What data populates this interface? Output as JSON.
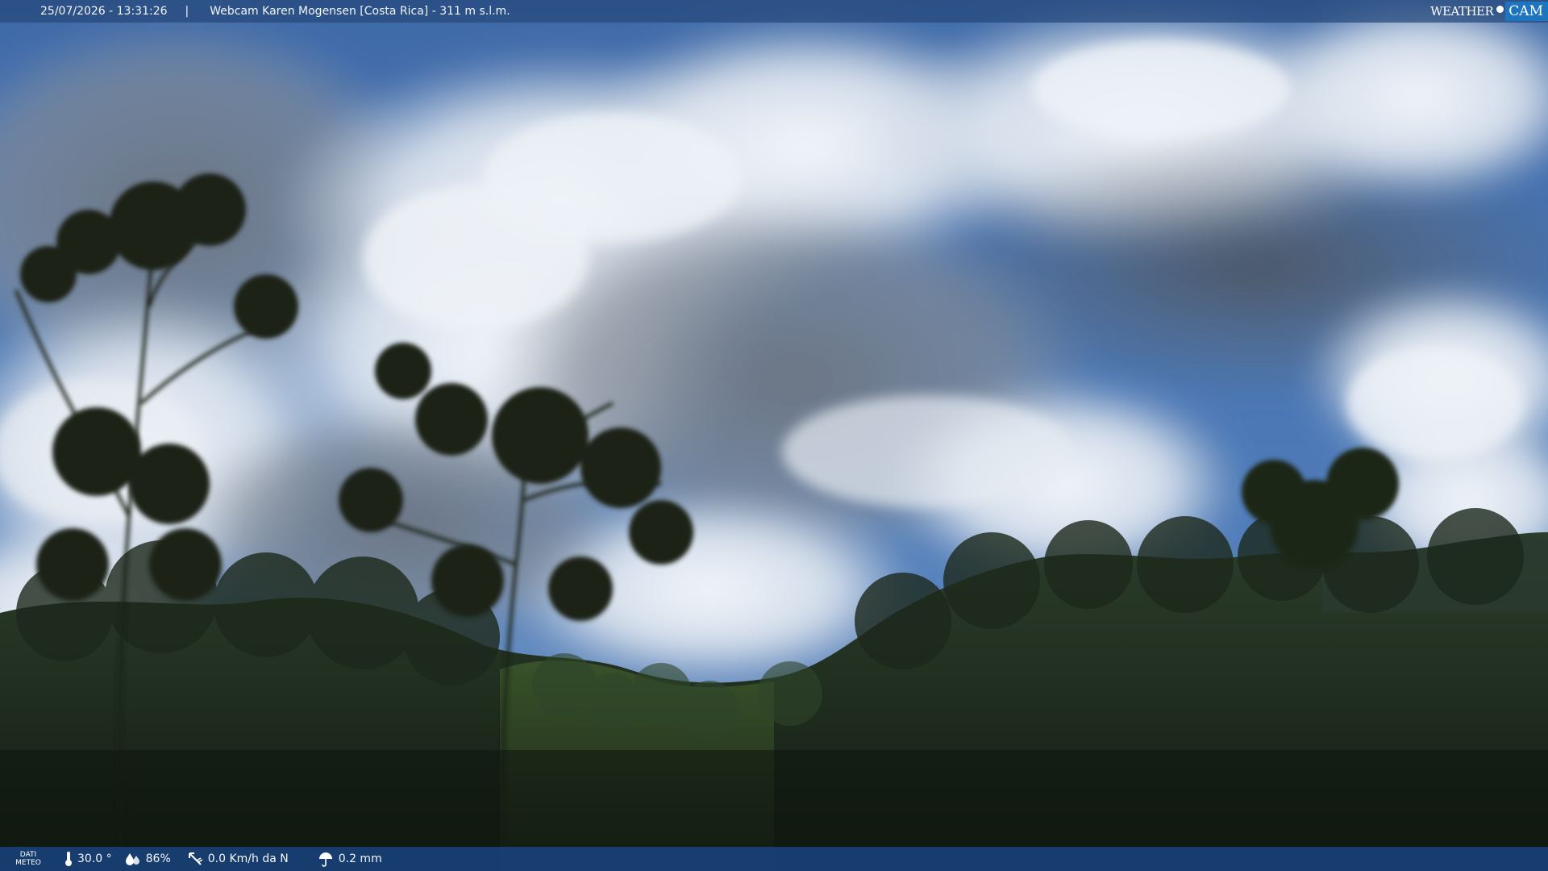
{
  "header": {
    "datetime": "25/07/2026 - 13:31:26",
    "separator": "|",
    "location": "Webcam Karen Mogensen [Costa Rica] - 311 m s.l.m."
  },
  "brand": {
    "word1": "WEATHER",
    "word2": "CAM",
    "accent_color": "#1d75bf"
  },
  "meteo": {
    "tag_line1": "DATI",
    "tag_line2": "METEO",
    "temperature": "30.0 °",
    "temperature_icon": "thermometer-icon",
    "humidity": "86%",
    "humidity_icon": "humidity-drops-icon",
    "wind": "0.0 Km/h da N",
    "wind_icon": "wind-arrow-icon",
    "rain": "0.2 mm",
    "rain_icon": "umbrella-icon"
  }
}
